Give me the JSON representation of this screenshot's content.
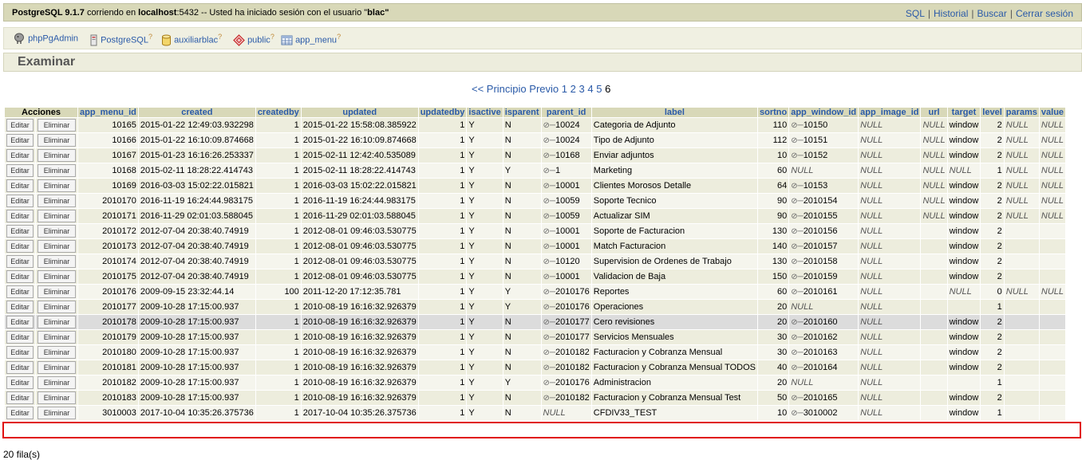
{
  "topbar": {
    "server_name": "PostgreSQL 9.1.7",
    "server_mid": " corriendo en ",
    "host": "localhost",
    "port_mid": ":5432 -- Usted ha iniciado sesión con el usuario \"",
    "user": "blac",
    "user_end": "\"",
    "links": [
      "SQL",
      "Historial",
      "Buscar",
      "Cerrar sesión"
    ]
  },
  "trail": [
    {
      "label": "phpPgAdmin",
      "icon": "elephant-icon",
      "help": ""
    },
    {
      "label": "PostgreSQL",
      "icon": "server-icon",
      "help": "?"
    },
    {
      "label": "auxiliarblac",
      "icon": "database-icon",
      "help": "?"
    },
    {
      "label": "public",
      "icon": "schema-icon",
      "help": "?"
    },
    {
      "label": "app_menu",
      "icon": "table-icon",
      "help": "?"
    }
  ],
  "title": "Examinar",
  "pager": {
    "first": "<< Principio",
    "prev": "Previo",
    "pages": [
      "1",
      "2",
      "3",
      "4",
      "5"
    ],
    "current": "6"
  },
  "table": {
    "actions_header": "Acciones",
    "edit_label": "Editar",
    "delete_label": "Eliminar",
    "columns": [
      "app_menu_id",
      "created",
      "createdby",
      "updated",
      "updatedby",
      "isactive",
      "isparent",
      "parent_id",
      "label",
      "sortno",
      "app_window_id",
      "app_image_id",
      "url",
      "target",
      "level",
      "params",
      "value"
    ],
    "rows": [
      [
        "10165",
        "2015-01-22 12:49:03.932298",
        "1",
        "2015-01-22 15:58:08.385922",
        "1",
        "Y",
        "N",
        "10024",
        "Categoria de Adjunto",
        "110",
        "10150",
        "NULL",
        "NULL",
        "window",
        "2",
        "NULL",
        "NULL"
      ],
      [
        "10166",
        "2015-01-22 16:10:09.874668",
        "1",
        "2015-01-22 16:10:09.874668",
        "1",
        "Y",
        "N",
        "10024",
        "Tipo de Adjunto",
        "112",
        "10151",
        "NULL",
        "NULL",
        "window",
        "2",
        "NULL",
        "NULL"
      ],
      [
        "10167",
        "2015-01-23 16:16:26.253337",
        "1",
        "2015-02-11 12:42:40.535089",
        "1",
        "Y",
        "N",
        "10168",
        "Enviar adjuntos",
        "10",
        "10152",
        "NULL",
        "NULL",
        "window",
        "2",
        "NULL",
        "NULL"
      ],
      [
        "10168",
        "2015-02-11 18:28:22.414743",
        "1",
        "2015-02-11 18:28:22.414743",
        "1",
        "Y",
        "Y",
        "1",
        "Marketing",
        "60",
        "NULL",
        "NULL",
        "NULL",
        "NULL",
        "1",
        "NULL",
        "NULL"
      ],
      [
        "10169",
        "2016-03-03 15:02:22.015821",
        "1",
        "2016-03-03 15:02:22.015821",
        "1",
        "Y",
        "N",
        "10001",
        "Clientes Morosos Detalle",
        "64",
        "10153",
        "NULL",
        "NULL",
        "window",
        "2",
        "NULL",
        "NULL"
      ],
      [
        "2010170",
        "2016-11-19 16:24:44.983175",
        "1",
        "2016-11-19 16:24:44.983175",
        "1",
        "Y",
        "N",
        "10059",
        "Soporte Tecnico",
        "90",
        "2010154",
        "NULL",
        "NULL",
        "window",
        "2",
        "NULL",
        "NULL"
      ],
      [
        "2010171",
        "2016-11-29 02:01:03.588045",
        "1",
        "2016-11-29 02:01:03.588045",
        "1",
        "Y",
        "N",
        "10059",
        "Actualizar SIM",
        "90",
        "2010155",
        "NULL",
        "NULL",
        "window",
        "2",
        "NULL",
        "NULL"
      ],
      [
        "2010172",
        "2012-07-04 20:38:40.74919",
        "1",
        "2012-08-01 09:46:03.530775",
        "1",
        "Y",
        "N",
        "10001",
        "Soporte de Facturacion",
        "130",
        "2010156",
        "NULL",
        "",
        "window",
        "2",
        "",
        ""
      ],
      [
        "2010173",
        "2012-07-04 20:38:40.74919",
        "1",
        "2012-08-01 09:46:03.530775",
        "1",
        "Y",
        "N",
        "10001",
        "Match Facturacion",
        "140",
        "2010157",
        "NULL",
        "",
        "window",
        "2",
        "",
        ""
      ],
      [
        "2010174",
        "2012-07-04 20:38:40.74919",
        "1",
        "2012-08-01 09:46:03.530775",
        "1",
        "Y",
        "N",
        "10120",
        "Supervision de Ordenes de Trabajo",
        "130",
        "2010158",
        "NULL",
        "",
        "window",
        "2",
        "",
        ""
      ],
      [
        "2010175",
        "2012-07-04 20:38:40.74919",
        "1",
        "2012-08-01 09:46:03.530775",
        "1",
        "Y",
        "N",
        "10001",
        "Validacion de Baja",
        "150",
        "2010159",
        "NULL",
        "",
        "window",
        "2",
        "",
        ""
      ],
      [
        "2010176",
        "2009-09-15 23:32:44.14",
        "100",
        "2011-12-20 17:12:35.781",
        "1",
        "Y",
        "Y",
        "2010176",
        "Reportes",
        "60",
        "2010161",
        "NULL",
        "",
        "NULL",
        "0",
        "NULL",
        "NULL"
      ],
      [
        "2010177",
        "2009-10-28 17:15:00.937",
        "1",
        "2010-08-19 16:16:32.926379",
        "1",
        "Y",
        "Y",
        "2010176",
        "Operaciones",
        "20",
        "NULL",
        "NULL",
        "",
        "",
        "1",
        "",
        ""
      ],
      [
        "2010178",
        "2009-10-28 17:15:00.937",
        "1",
        "2010-08-19 16:16:32.926379",
        "1",
        "Y",
        "N",
        "2010177",
        "Cero revisiones",
        "20",
        "2010160",
        "NULL",
        "",
        "window",
        "2",
        "",
        ""
      ],
      [
        "2010179",
        "2009-10-28 17:15:00.937",
        "1",
        "2010-08-19 16:16:32.926379",
        "1",
        "Y",
        "N",
        "2010177",
        "Servicios Mensuales",
        "30",
        "2010162",
        "NULL",
        "",
        "window",
        "2",
        "",
        ""
      ],
      [
        "2010180",
        "2009-10-28 17:15:00.937",
        "1",
        "2010-08-19 16:16:32.926379",
        "1",
        "Y",
        "N",
        "2010182",
        "Facturacion y Cobranza Mensual",
        "30",
        "2010163",
        "NULL",
        "",
        "window",
        "2",
        "",
        ""
      ],
      [
        "2010181",
        "2009-10-28 17:15:00.937",
        "1",
        "2010-08-19 16:16:32.926379",
        "1",
        "Y",
        "N",
        "2010182",
        "Facturacion y Cobranza Mensual TODOS",
        "40",
        "2010164",
        "NULL",
        "",
        "window",
        "2",
        "",
        ""
      ],
      [
        "2010182",
        "2009-10-28 17:15:00.937",
        "1",
        "2010-08-19 16:16:32.926379",
        "1",
        "Y",
        "Y",
        "2010176",
        "Administracion",
        "20",
        "NULL",
        "NULL",
        "",
        "",
        "1",
        "",
        ""
      ],
      [
        "2010183",
        "2009-10-28 17:15:00.937",
        "1",
        "2010-08-19 16:16:32.926379",
        "1",
        "Y",
        "N",
        "2010182",
        "Facturacion y Cobranza Mensual Test",
        "50",
        "2010165",
        "NULL",
        "",
        "window",
        "2",
        "",
        ""
      ],
      [
        "3010003",
        "2017-10-04 10:35:26.375736",
        "1",
        "2017-10-04 10:35:26.375736",
        "1",
        "Y",
        "N",
        "NULL",
        "CFDIV33_TEST",
        "10",
        "3010002",
        "NULL",
        "",
        "window",
        "1",
        "",
        ""
      ]
    ]
  },
  "footer": {
    "row_count": "20 fila(s)"
  },
  "colors": {
    "header_bg": "#d8d8b8",
    "link": "#2a5aa8",
    "highlight_border": "#e01010"
  }
}
